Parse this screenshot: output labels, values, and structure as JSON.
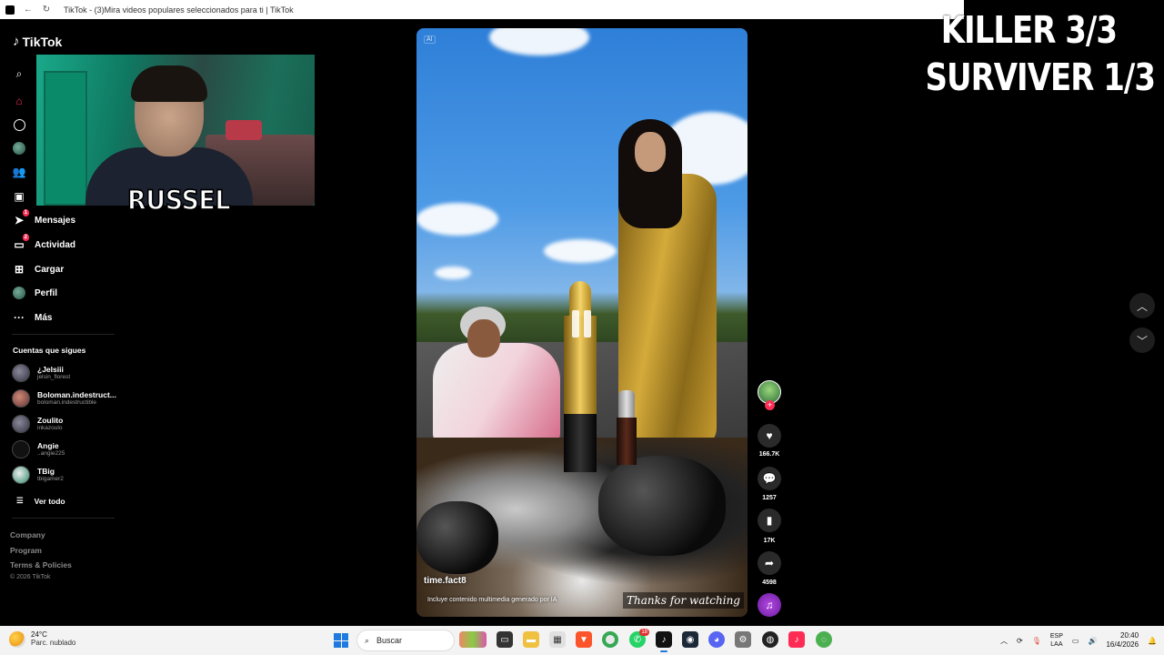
{
  "browser": {
    "title": "TikTok - (3)Mira videos populares seleccionados para ti | TikTok"
  },
  "overlay": {
    "line1": "KILLER 3/3",
    "line2": "SURVIVER 1/3"
  },
  "webcam": {
    "nameplate": "RUSSEL"
  },
  "sidebar": {
    "logo": "TikTok",
    "nav": [
      {
        "label": "Mensajes",
        "badge": "1"
      },
      {
        "label": "Actividad",
        "badge": "2"
      },
      {
        "label": "Cargar"
      },
      {
        "label": "Perfil"
      },
      {
        "label": "Más"
      }
    ],
    "following_title": "Cuentas que sigues",
    "following": [
      {
        "name": "¿Jelsiii",
        "handle": "jelsin_florest"
      },
      {
        "name": "Boloman.indestruct...",
        "handle": "boloman.indestructible"
      },
      {
        "name": "Zoulito",
        "handle": "inkazoulo"
      },
      {
        "name": "Angie",
        "handle": "..angie225"
      },
      {
        "name": "TBig",
        "handle": "tbigamer2"
      }
    ],
    "see_all": "Ver todo",
    "footer": [
      "Company",
      "Program",
      "Terms & Policies"
    ],
    "copyright": "© 2026 TikTok"
  },
  "video": {
    "ai_tag": "AI",
    "author": "time.fact8",
    "ai_note": "Incluye contenido multimedia generado por IA",
    "thanks": "Thanks for watching"
  },
  "actions": {
    "likes": "166.7K",
    "comments": "1257",
    "saves": "17K",
    "shares": "4598"
  },
  "taskbar": {
    "temp": "24°C",
    "weather": "Parc. nublado",
    "search": "Buscar",
    "whatsapp_badge": "18",
    "lang_top": "ESP",
    "lang_bottom": "LAA",
    "time": "20:40",
    "date": "16/4/2026"
  },
  "colors": {
    "accent": "#fe2c55",
    "windows_blue": "#1f7ae0"
  }
}
